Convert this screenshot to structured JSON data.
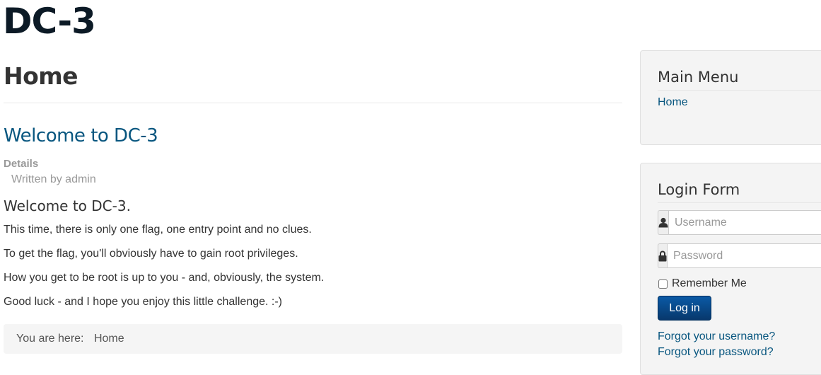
{
  "site": {
    "title": "DC-3"
  },
  "main": {
    "page_title": "Home",
    "article": {
      "title": "Welcome to DC-3",
      "details_label": "Details",
      "written_by": "Written by admin",
      "heading": "Welcome to DC-3.",
      "paragraphs": [
        "This time, there is only one flag, one entry point and no clues.",
        "To get the flag, you'll obviously have to gain root privileges.",
        "How you get to be root is up to you - and, obviously, the system.",
        "Good luck - and I hope you enjoy this little challenge.  :-)"
      ]
    },
    "breadcrumb": {
      "label": "You are here:",
      "current": "Home"
    }
  },
  "sidebar": {
    "main_menu": {
      "title": "Main Menu",
      "items": [
        {
          "label": "Home"
        }
      ]
    },
    "login_form": {
      "title": "Login Form",
      "username_placeholder": "Username",
      "password_placeholder": "Password",
      "remember_label": "Remember Me",
      "login_button": "Log in",
      "forgot_username": "Forgot your username?",
      "forgot_password": "Forgot your password?",
      "username_icon": "user-icon",
      "password_icon": "lock-icon"
    }
  },
  "colors": {
    "link": "#08567f",
    "button": "#08386c",
    "sidebar_bg": "#f4f4f4"
  }
}
